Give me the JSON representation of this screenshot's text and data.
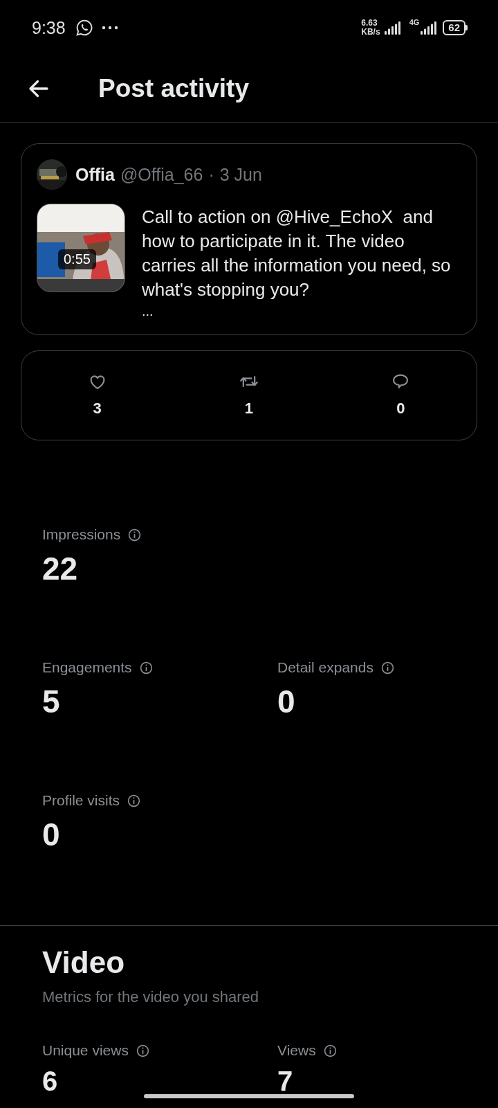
{
  "status_bar": {
    "time": "9:38",
    "speed_value": "6.63",
    "speed_unit": "KB/s",
    "network": "4G",
    "battery": "62"
  },
  "header": {
    "title": "Post activity"
  },
  "post": {
    "name": "Offia",
    "handle": "@Offia_66",
    "dot": "·",
    "date": "3 Jun",
    "media": {
      "kind": "picture",
      "duration": "0:55"
    },
    "text": "Call to action on @Hive_EchoX  and how to participate in it. The video carries all the information you need, so what's stopping you?",
    "more": "..."
  },
  "engagement": [
    {
      "kind": "like",
      "count": "3"
    },
    {
      "kind": "repost",
      "count": "1"
    },
    {
      "kind": "reply",
      "count": "0"
    }
  ],
  "metric_rows": [
    [
      {
        "label": "Impressions",
        "value": "22"
      }
    ],
    [
      {
        "label": "Engagements",
        "value": "5"
      },
      {
        "label": "Detail expands",
        "value": "0"
      }
    ],
    [
      {
        "label": "Profile visits",
        "value": "0"
      }
    ]
  ],
  "video": {
    "title": "Video",
    "subtitle": "Metrics for the video you shared",
    "metrics": [
      {
        "label": "Unique views",
        "value": "6"
      },
      {
        "label": "Views",
        "value": "7"
      }
    ]
  }
}
